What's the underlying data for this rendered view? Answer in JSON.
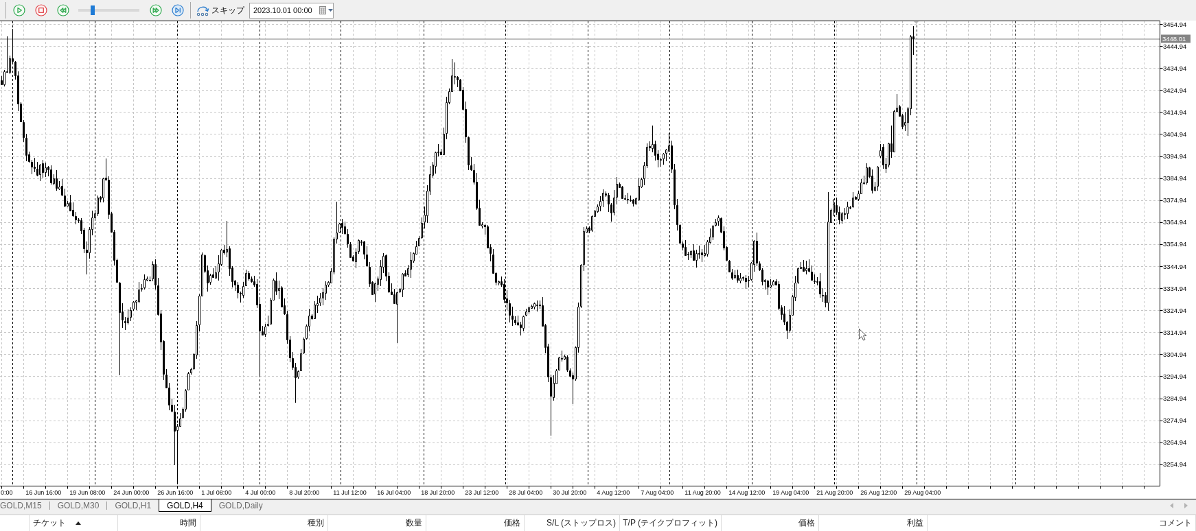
{
  "toolbar": {
    "speed_slider": {
      "level": 0.22
    },
    "skip_button": {
      "label": "スキップ"
    },
    "date_field": {
      "value": "2023.10.01 00:00"
    }
  },
  "chart": {
    "price_axis": {
      "labels": [
        "3454.94",
        "3444.94",
        "3434.94",
        "3424.94",
        "3414.94",
        "3404.94",
        "3394.94",
        "3384.94",
        "3374.94",
        "3364.94",
        "3354.94",
        "3344.94",
        "3334.94",
        "3324.94",
        "3314.94",
        "3304.94",
        "3294.94",
        "3284.94",
        "3274.94",
        "3264.94",
        "3254.94"
      ]
    },
    "current_price": {
      "label": "3448.01"
    },
    "time_axis": {
      "labels": [
        "0:00",
        "16 Jun 16:00",
        "19 Jun 08:00",
        "24 Jun 00:00",
        "26 Jun 16:00",
        "1 Jul 08:00",
        "4 Jul 00:00",
        "8 Jul 20:00",
        "11 Jul 12:00",
        "16 Jul 04:00",
        "18 Jul 20:00",
        "23 Jul 12:00",
        "28 Jul 04:00",
        "30 Jul 20:00",
        "4 Aug 12:00",
        "7 Aug 04:00",
        "11 Aug 20:00",
        "14 Aug 12:00",
        "19 Aug 04:00",
        "21 Aug 20:00",
        "26 Aug 12:00",
        "29 Aug 04:00"
      ]
    }
  },
  "tabs": [
    {
      "label": "GOLD,M15",
      "selected": false
    },
    {
      "label": "GOLD,M30",
      "selected": false
    },
    {
      "label": "GOLD,H1",
      "selected": false
    },
    {
      "label": "GOLD,H4",
      "selected": true
    },
    {
      "label": "GOLD,Daily",
      "selected": false
    }
  ],
  "table": {
    "columns": [
      {
        "label": "チケット",
        "sorted": true
      },
      {
        "label": "時間",
        "sorted": false
      },
      {
        "label": "種別",
        "sorted": false
      },
      {
        "label": "数量",
        "sorted": false
      },
      {
        "label": "価格",
        "sorted": false
      },
      {
        "label": "S/L (ストップロス)",
        "sorted": false
      },
      {
        "label": "T/P (テイクプロフィット)",
        "sorted": false
      },
      {
        "label": "価格",
        "sorted": false
      },
      {
        "label": "利益",
        "sorted": false
      },
      {
        "label": "コメント",
        "sorted": false
      }
    ]
  }
}
